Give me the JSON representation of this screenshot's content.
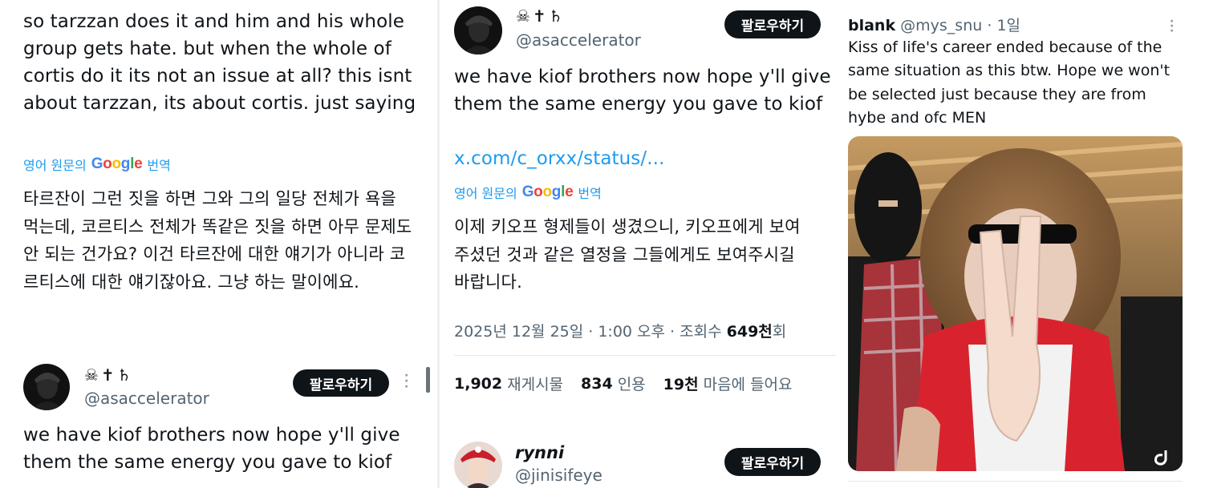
{
  "left": {
    "post_text": "so tarzzan does it and him and his whole group gets hate. but when the whole of cortis do it its not an issue at all? this isnt about tarzzan, its about cortis. just saying",
    "translate": {
      "prefix": "영어 원문의",
      "google": [
        "G",
        "o",
        "o",
        "g",
        "l",
        "e"
      ],
      "suffix": "번역"
    },
    "korean_text": "타르잔이 그런 짓을 하면 그와 그의 일당 전체가 욕을 먹는데, 코르티스 전체가 똑같은 짓을 하면 아무 문제도 안 되는 건가요? 이건 타르잔에 대한 얘기가 아니라 코르티스에 대한 얘기잖아요. 그냥 하는 말이에요.",
    "author": {
      "display_name": "☠✝♄",
      "handle": "@asaccelerator",
      "follow_label": "팔로우하기",
      "more_icon": "more-vertical-icon"
    },
    "reply_text": "we have kiof brothers now hope y'll give them the same energy you gave to kiof"
  },
  "middle": {
    "author": {
      "display_name": "☠✝♄",
      "handle": "@asaccelerator",
      "follow_label": "팔로우하기"
    },
    "post_text": "we have kiof brothers now hope y'll give them the same energy you gave to kiof",
    "link_text": "x.com/c_orxx/status/...",
    "translate": {
      "prefix": "영어 원문의",
      "google": [
        "G",
        "o",
        "o",
        "g",
        "l",
        "e"
      ],
      "suffix": "번역"
    },
    "korean_text": "이제 키오프 형제들이 생겼으니, 키오프에게 보여주셨던 것과 같은 열정을 그들에게도 보여주시길 바랍니다.",
    "timestamp": "2025년 12월 25일 · 1:00 오후 · 조회수",
    "views_value": "649천",
    "views_suffix": "회",
    "stats": {
      "reposts_value": "1,902",
      "reposts_label": "재게시물",
      "quotes_value": "834",
      "quotes_label": "인용",
      "likes_value": "19천",
      "likes_label": "마음에 들어요"
    },
    "reply_author": {
      "display_name": "rynni",
      "handle": "@jinisifeye",
      "follow_label": "팔로우하기"
    }
  },
  "right": {
    "author_name": "blank",
    "handle": "@mys_snu",
    "separator": "·",
    "time": "1일",
    "more_icon": "more-vertical-icon",
    "post_text": "Kiss of life's career ended because of the same situation as this btw. Hope we won't be selected just because they are from hybe and ofc MEN",
    "media_icon": "tiktok-icon"
  },
  "colors": {
    "text": "#0f1419",
    "secondary": "#536471",
    "link": "#1d9bf0",
    "button_bg": "#0f1419"
  }
}
